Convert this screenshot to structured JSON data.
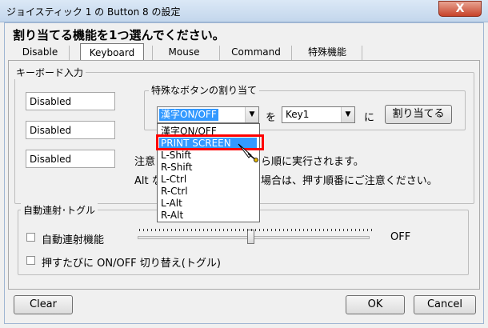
{
  "window": {
    "title": "ジョイスティック 1 の Button 8 の設定",
    "close_glyph": "X"
  },
  "instruction": "割り当てる機能を1つ選んでください。",
  "tabs": [
    "Disable",
    "Keyboard",
    "Mouse",
    "Command",
    "特殊機能"
  ],
  "selected_tab": "Keyboard",
  "keyboard_group": {
    "legend": "キーボード入力",
    "fields": [
      "Disabled",
      "Disabled",
      "Disabled"
    ]
  },
  "special_group": {
    "legend": "特殊なボタンの割り当て",
    "combo_value": "漢字ON/OFF",
    "wo_label": "を",
    "key_value": "Key1",
    "ni_label": "に",
    "assign_button": "割り当てる",
    "note_line1": "注意",
    "note_line1_rest": "ら順に実行されます。",
    "note_line2": "Alt な",
    "note_line2_rest": "場合は、押す順番にご注意ください。",
    "dropdown_items": [
      "漢字ON/OFF",
      "PRINT SCREEN",
      "L-Shift",
      "R-Shift",
      "L-Ctrl",
      "R-Ctrl",
      "L-Alt",
      "R-Alt"
    ],
    "dropdown_selected": "PRINT SCREEN",
    "highlight_color": "#ff0000"
  },
  "toggle_group": {
    "legend": "自動連射･トグル",
    "auto_fire_label": "自動連射機能",
    "slider_value": "OFF",
    "toggle_label": "押すたびに ON/OFF 切り替え(トグル)"
  },
  "buttons": {
    "clear": "Clear",
    "ok": "OK",
    "cancel": "Cancel"
  }
}
